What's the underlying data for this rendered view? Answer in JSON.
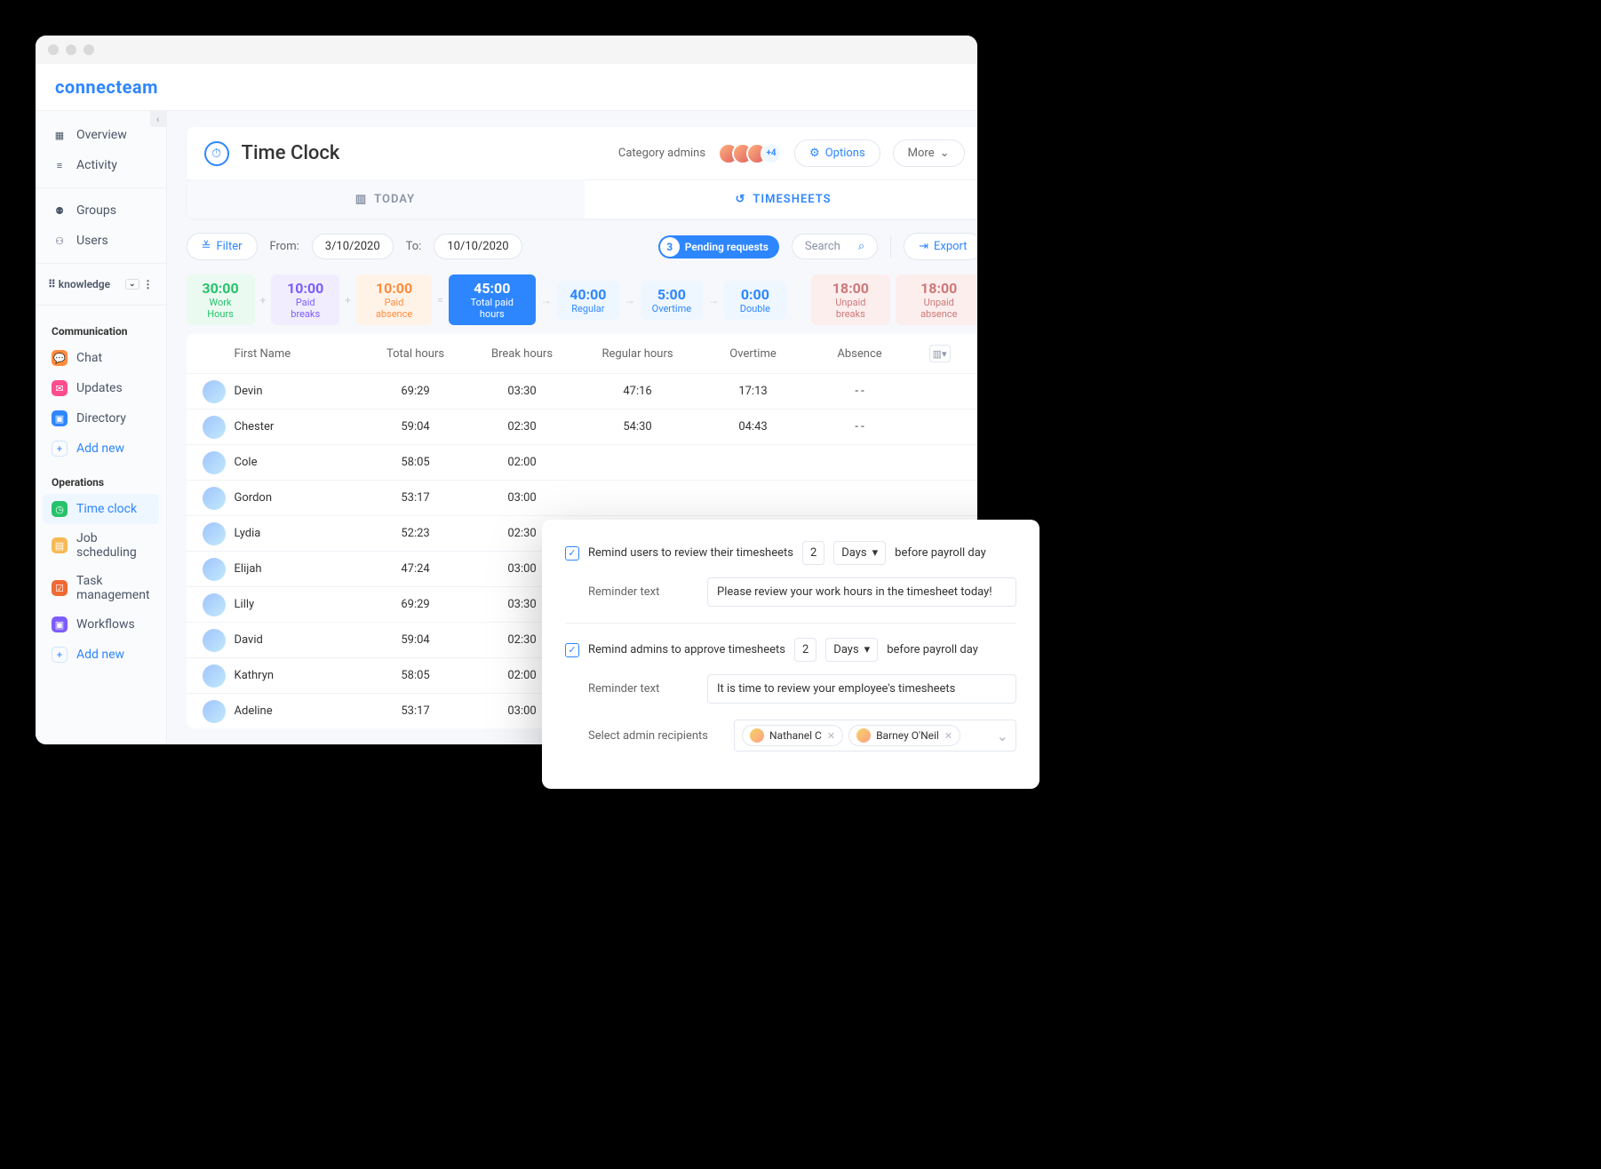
{
  "brand": "connecteam",
  "sidebar": {
    "top": [
      {
        "label": "Overview",
        "icon": "grid"
      },
      {
        "label": "Activity",
        "icon": "lines"
      }
    ],
    "mid": [
      {
        "label": "Groups",
        "icon": "user"
      },
      {
        "label": "Users",
        "icon": "user"
      }
    ],
    "knowledge_label": "knowledge",
    "comm_label": "Communication",
    "comm": [
      {
        "label": "Chat",
        "color": "orange"
      },
      {
        "label": "Updates",
        "color": "pink"
      },
      {
        "label": "Directory",
        "color": "blue"
      }
    ],
    "ops_label": "Operations",
    "ops": [
      {
        "label": "Time clock",
        "color": "green",
        "active": true
      },
      {
        "label": "Job scheduling",
        "color": "yellow"
      },
      {
        "label": "Task management",
        "color": "darkorange"
      },
      {
        "label": "Workflows",
        "color": "purple"
      }
    ],
    "add_new": "Add new"
  },
  "header": {
    "title": "Time Clock",
    "category_admins": "Category admins",
    "more_count": "+4",
    "options": "Options",
    "more": "More"
  },
  "tabs": {
    "today": "TODAY",
    "timesheets": "TIMESHEETS"
  },
  "toolbar": {
    "filter": "Filter",
    "from_label": "From:",
    "from": "3/10/2020",
    "to_label": "To:",
    "to": "10/10/2020",
    "pending_count": "3",
    "pending_label": "Pending requests",
    "search_placeholder": "Search",
    "export": "Export"
  },
  "summary": [
    {
      "value": "30:00",
      "label": "Work Hours",
      "cls": "green",
      "op": "+"
    },
    {
      "value": "10:00",
      "label": "Paid breaks",
      "cls": "purple",
      "op": "+"
    },
    {
      "value": "10:00",
      "label": "Paid absence",
      "cls": "orange",
      "op": "="
    },
    {
      "value": "45:00",
      "label": "Total paid hours",
      "cls": "blue",
      "op": "→"
    },
    {
      "value": "40:00",
      "label": "Regular",
      "cls": "lblue",
      "op": "→"
    },
    {
      "value": "5:00",
      "label": "Overtime",
      "cls": "lblue",
      "op": "→"
    },
    {
      "value": "0:00",
      "label": "Double",
      "cls": "lblue",
      "op": ""
    },
    {
      "value": "18:00",
      "label": "Unpaid breaks",
      "cls": "red",
      "op": ""
    },
    {
      "value": "18:00",
      "label": "Unpaid absence",
      "cls": "red",
      "op": ""
    }
  ],
  "columns": {
    "c0": "First Name",
    "c1": "Total hours",
    "c2": "Break hours",
    "c3": "Regular hours",
    "c4": "Overtime",
    "c5": "Absence"
  },
  "rows": [
    {
      "name": "Devin",
      "total": "69:29",
      "break": "03:30",
      "reg": "47:16",
      "ot": "17:13",
      "abs": "- -"
    },
    {
      "name": "Chester",
      "total": "59:04",
      "break": "02:30",
      "reg": "54:30",
      "ot": "04:43",
      "abs": "- -"
    },
    {
      "name": "Cole",
      "total": "58:05",
      "break": "02:00",
      "reg": "",
      "ot": "",
      "abs": ""
    },
    {
      "name": "Gordon",
      "total": "53:17",
      "break": "03:00",
      "reg": "",
      "ot": "",
      "abs": ""
    },
    {
      "name": "Lydia",
      "total": "52:23",
      "break": "02:30",
      "reg": "",
      "ot": "",
      "abs": ""
    },
    {
      "name": "Elijah",
      "total": "47:24",
      "break": "03:00",
      "reg": "",
      "ot": "",
      "abs": ""
    },
    {
      "name": "Lilly",
      "total": "69:29",
      "break": "03:30",
      "reg": "",
      "ot": "",
      "abs": ""
    },
    {
      "name": "David",
      "total": "59:04",
      "break": "02:30",
      "reg": "",
      "ot": "",
      "abs": ""
    },
    {
      "name": "Kathryn",
      "total": "58:05",
      "break": "02:00",
      "reg": "",
      "ot": "",
      "abs": ""
    },
    {
      "name": "Adeline",
      "total": "53:17",
      "break": "03:00",
      "reg": "",
      "ot": "",
      "abs": ""
    }
  ],
  "popup": {
    "r1": "Remind users to review their timesheets",
    "days_val": "2",
    "days_label": "Days",
    "suffix": "before payroll day",
    "reminder_text_label": "Reminder text",
    "r1_text": "Please review your work hours in the timesheet today!",
    "r2": "Remind admins to approve timesheets",
    "r2_text": "It is time to review your employee's timesheets",
    "recipients_label": "Select admin recipients",
    "recipients": [
      {
        "name": "Nathanel C"
      },
      {
        "name": "Barney O'Neil"
      }
    ]
  }
}
